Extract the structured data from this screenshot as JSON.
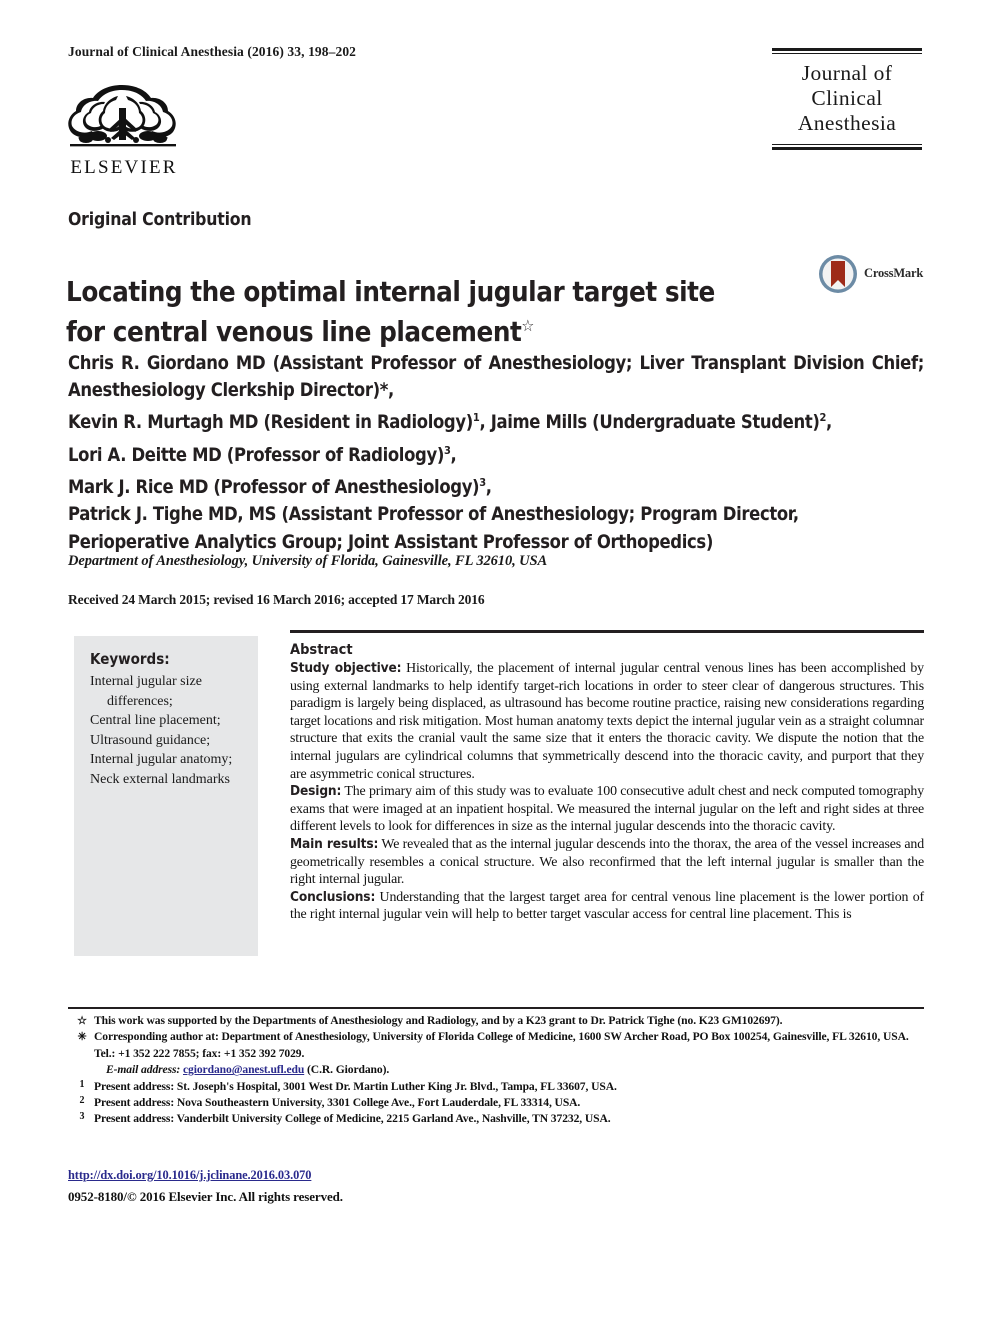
{
  "header": {
    "journal_ref": "Journal of Clinical Anesthesia (2016) 33, 198–202",
    "publisher_name": "ELSEVIER",
    "publisher_logo_icon": "elsevier-tree-icon",
    "masthead": {
      "line1": "Journal of",
      "line2": "Clinical",
      "line3": "Anesthesia"
    }
  },
  "article": {
    "section_label": "Original Contribution",
    "title_line1": "Locating the optimal internal jugular target site",
    "title_line2": "for central venous line placement",
    "title_footnote_mark": "☆",
    "crossmark": {
      "label": "CrossMark",
      "icon": "crossmark-badge-icon"
    },
    "authors": [
      "Chris R. Giordano MD (Assistant Professor of Anesthesiology; Liver Transplant Division Chief; Anesthesiology Clerkship Director)*,",
      "Kevin R. Murtagh MD (Resident in Radiology) 1 , Jaime Mills (Undergraduate Student) 2 ,",
      "Lori A. Deitte MD (Professor of Radiology) 3 ,",
      "Mark J. Rice MD (Professor of Anesthesiology) 3 ,",
      "Patrick J. Tighe MD, MS (Assistant Professor of Anesthesiology; Program Director, Perioperative Analytics Group; Joint Assistant Professor of Orthopedics)"
    ],
    "author_parts": {
      "a1_text": "Chris R. Giordano MD (Assistant Professor of Anesthesiology; Liver Transplant Division Chief; Anesthesiology Clerkship Director)*,",
      "a2_name": "Kevin R. Murtagh MD (Resident in Radiology)",
      "a2_sup": "1",
      "a2_sep": ", ",
      "a3_name": "Jaime Mills (Undergraduate Student)",
      "a3_sup": "2",
      "a3_sep": ",",
      "a4_name": "Lori A. Deitte MD (Professor of Radiology)",
      "a4_sup": "3",
      "a4_sep": ",",
      "a5_name": "Mark J. Rice MD (Professor of Anesthesiology)",
      "a5_sup": "3",
      "a5_sep": ",",
      "a6_line1": "Patrick J. Tighe MD, MS (Assistant Professor of Anesthesiology; Program Director,",
      "a6_line2": "Perioperative Analytics Group; Joint Assistant Professor of Orthopedics)"
    },
    "affiliation": "Department of Anesthesiology, University of Florida, Gainesville, FL 32610, USA",
    "dates": "Received 24 March 2015; revised 16 March 2016; accepted 17 March 2016"
  },
  "keywords": {
    "title": "Keywords:",
    "items": [
      {
        "main": "Internal jugular size",
        "cont": "differences;"
      },
      {
        "main": "Central line placement;",
        "cont": ""
      },
      {
        "main": "Ultrasound guidance;",
        "cont": ""
      },
      {
        "main": "Internal jugular anatomy;",
        "cont": ""
      },
      {
        "main": "Neck external landmarks",
        "cont": ""
      }
    ]
  },
  "abstract": {
    "heading": "Abstract",
    "sections": [
      {
        "label": "Study objective:",
        "text": " Historically, the placement of internal jugular central venous lines has been accomplished by using external landmarks to help identify target-rich locations in order to steer clear of dangerous structures. This paradigm is largely being displaced, as ultrasound has become routine practice, raising new considerations regarding target locations and risk mitigation. Most human anatomy texts depict the internal jugular vein as a straight columnar structure that exits the cranial vault the same size that it enters the thoracic cavity. We dispute the notion that the internal jugulars are cylindrical columns that symmetrically descend into the thoracic cavity, and purport that they are asymmetric conical structures."
      },
      {
        "label": "Design:",
        "text": " The primary aim of this study was to evaluate 100 consecutive adult chest and neck computed tomography exams that were imaged at an inpatient hospital. We measured the internal jugular on the left and right sides at three different levels to look for differences in size as the internal jugular descends into the thoracic cavity."
      },
      {
        "label": "Main results:",
        "text": " We revealed that as the internal jugular descends into the thorax, the area of the vessel increases and geometrically resembles a conical structure. We also reconfirmed that the left internal jugular is smaller than the right internal jugular."
      },
      {
        "label": "Conclusions:",
        "text": " Understanding that the largest target area for central venous line placement is the lower portion of the right internal jugular vein will help to better target vascular access for central line placement. This is"
      }
    ]
  },
  "footnotes": [
    {
      "mark": "☆",
      "text": "This work was supported by the Departments of Anesthesiology and Radiology, and by a K23 grant to Dr. Patrick Tighe (no. K23 GM102697)."
    },
    {
      "mark": "✳",
      "text": "Corresponding author at: Department of Anesthesiology, University of Florida College of Medicine, 1600 SW Archer Road, PO Box 100254, Gainesville, FL 32610, USA. Tel.: +1 352 222 7855; fax: +1 352 392 7029."
    },
    {
      "mark": "1",
      "text": "Present address: St. Joseph's Hospital, 3001 West Dr. Martin Luther King Jr. Blvd., Tampa, FL 33607, USA."
    },
    {
      "mark": "2",
      "text": "Present address: Nova Southeastern University, 3301 College Ave., Fort Lauderdale, FL 33314, USA."
    },
    {
      "mark": "3",
      "text": "Present address: Vanderbilt University College of Medicine, 2215 Garland Ave., Nashville, TN 37232, USA."
    }
  ],
  "email_note": {
    "label": "E-mail address:",
    "address": "cgiordano@anest.ufl.edu",
    "attribution": "(C.R. Giordano)."
  },
  "footer": {
    "doi": "http://dx.doi.org/10.1016/j.jclinane.2016.03.070",
    "copyright": "0952-8180/© 2016 Elsevier Inc. All rights reserved."
  },
  "colors": {
    "link": "#2a2a8c",
    "keywords_bg": "#e6e7e8",
    "rule": "#231f20",
    "crossmark_red": "#9e2b19",
    "crossmark_blue": "#6c8ba5"
  }
}
